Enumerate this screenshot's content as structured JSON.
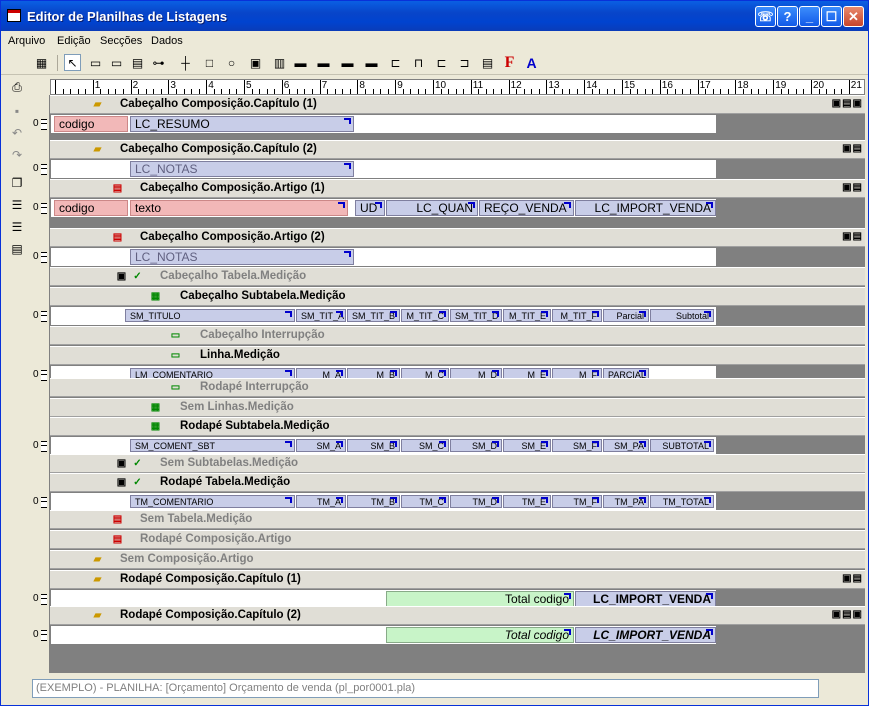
{
  "window": {
    "title": "Editor de Planilhas de Listagens"
  },
  "title_buttons": [
    {
      "name": "context-help-button",
      "glyph": "☏"
    },
    {
      "name": "help-button",
      "glyph": "?"
    },
    {
      "name": "minimize-button",
      "glyph": "_"
    },
    {
      "name": "maximize-button",
      "glyph": "☐"
    },
    {
      "name": "close-button",
      "glyph": "✕"
    }
  ],
  "menu": [
    "Arquivo",
    "Edição",
    "Secções",
    "Dados"
  ],
  "ruler": {
    "numbers": [
      "1",
      "2",
      "3",
      "4",
      "5",
      "6",
      "7",
      "8",
      "9",
      "10",
      "11",
      "12",
      "13",
      "14",
      "15",
      "16",
      "17",
      "18",
      "19",
      "20",
      "21"
    ]
  },
  "bands": {
    "b1": "Cabeçalho Composição.Capítulo (1)",
    "b2": "Cabeçalho Composição.Capítulo (2)",
    "b3": "Cabeçalho Composição.Artigo (1)",
    "b4": "Cabeçalho Composição.Artigo (2)",
    "b5": "Cabeçalho Tabela.Medição",
    "b6": "Cabeçalho Subtabela.Medição",
    "b7": "Cabeçalho Interrupção",
    "b8": "Linha.Medição",
    "b9": "Rodapé Interrupção",
    "b10": "Sem Linhas.Medição",
    "b11": "Rodapé Subtabela.Medição",
    "b12": "Sem Subtabelas.Medição",
    "b13": "Rodapé Tabela.Medição",
    "b14": "Sem Tabela.Medição",
    "b15": "Rodapé Composição.Artigo",
    "b16": "Sem Composição.Artigo",
    "b17": "Rodapé Composição.Capítulo (1)",
    "b18": "Rodapé Composição.Capítulo (2)"
  },
  "fields": {
    "d1": [
      "codigo",
      "LC_RESUMO"
    ],
    "d2": [
      "LC_NOTAS"
    ],
    "d3": [
      "codigo",
      "texto",
      "UD",
      "LC_QUAN",
      "REÇO_VENDA",
      "LC_IMPORT_VENDA"
    ],
    "d4": [
      "LC_NOTAS"
    ],
    "d6": [
      "SM_TITULO",
      "SM_TIT_A",
      "SM_TIT_B",
      "M_TIT_C",
      "SM_TIT_D",
      "M_TIT_E",
      "M_TIT_F",
      "Parcial",
      "Subtotal"
    ],
    "d8": [
      "LM_COMENTARIO",
      "M_A",
      "M_B",
      "M_C",
      "M_D",
      "M_E",
      "M_F",
      "PARCIAL"
    ],
    "d11": [
      "SM_COMENT_SBT",
      "SM_A",
      "SM_B",
      "SM_C",
      "SM_D",
      "SM_E",
      "SM_F",
      "SM_PA",
      "SUBTOTAL"
    ],
    "d13": [
      "TM_COMENTARIO",
      "TM_A",
      "TM_B",
      "TM_C",
      "TM_D",
      "TM_E",
      "TM_F",
      "TM_PA",
      "TM_TOTAL"
    ],
    "d17": [
      "Total codigo",
      "LC_IMPORT_VENDA"
    ],
    "d18": [
      "Total codigo",
      "LC_IMPORT_VENDA"
    ]
  },
  "gutter_mark": "0",
  "status": "(EXEMPLO) - PLANILHA: [Orçamento] Orçamento de venda (pl_por0001.pla)"
}
